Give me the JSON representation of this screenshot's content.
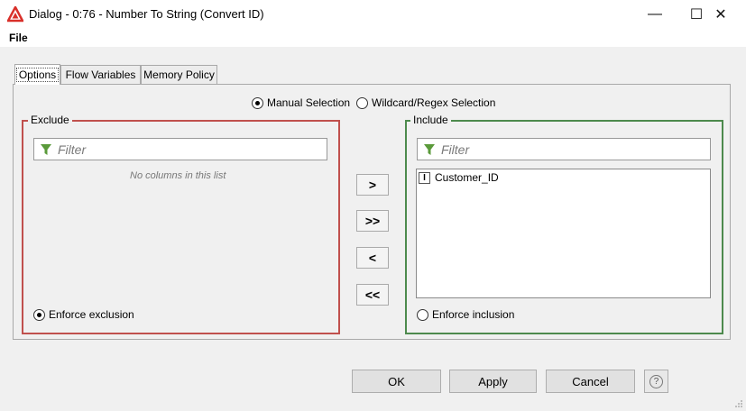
{
  "window": {
    "title": "Dialog - 0:76 - Number To String (Convert ID)",
    "controls": {
      "minimize": "—",
      "maximize": "☐",
      "close": "✕"
    }
  },
  "menu": {
    "items": [
      "File"
    ]
  },
  "tabs": [
    "Options",
    "Flow Variables",
    "Memory Policy"
  ],
  "active_tab": "Options",
  "selection_mode": {
    "options": [
      "Manual Selection",
      "Wildcard/Regex Selection"
    ],
    "selected": "Manual Selection"
  },
  "exclude": {
    "legend": "Exclude",
    "filter_placeholder": "Filter",
    "empty_message": "No columns in this list",
    "enforce_label": "Enforce exclusion",
    "enforce_selected": true
  },
  "include": {
    "legend": "Include",
    "filter_placeholder": "Filter",
    "columns": [
      {
        "type_icon": "I",
        "name": "Customer_ID"
      }
    ],
    "enforce_label": "Enforce inclusion",
    "enforce_selected": false
  },
  "transfer_buttons": {
    "add": ">",
    "add_all": ">>",
    "remove": "<",
    "remove_all": "<<"
  },
  "footer": {
    "ok": "OK",
    "apply": "Apply",
    "cancel": "Cancel",
    "help": "?"
  },
  "colors": {
    "exclude_border": "#c0504d",
    "include_border": "#4d8a4d",
    "logo": "#d9302a",
    "filter_icon": "#5a9a3a"
  },
  "icons": {
    "logo": "knime-triangle-icon",
    "filter": "funnel-icon",
    "column_type": "integer-type-icon",
    "help": "question-circle-icon"
  }
}
